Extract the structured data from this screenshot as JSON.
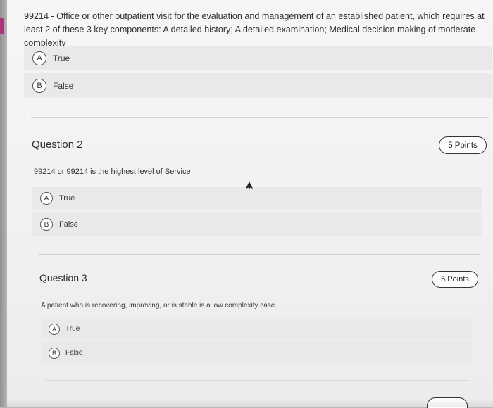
{
  "questions": [
    {
      "text": "99214 - Office or other outpatient visit for the evaluation and management of an established patient, which requires at least 2 of these 3 key components: A detailed history; A detailed examination; Medical decision making of moderate complexity",
      "options": [
        {
          "letter": "A",
          "label": "True"
        },
        {
          "letter": "B",
          "label": "False"
        }
      ]
    },
    {
      "title": "Question 2",
      "points": "5 Points",
      "text": "99214 or 99214 is the highest level of Service",
      "options": [
        {
          "letter": "A",
          "label": "True"
        },
        {
          "letter": "B",
          "label": "False"
        }
      ]
    },
    {
      "title": "Question 3",
      "points": "5 Points",
      "text": "A patient who is recovering, improving, or is stable is a low complexity case.",
      "options": [
        {
          "letter": "A",
          "label": "True"
        },
        {
          "letter": "B",
          "label": "False"
        }
      ]
    }
  ],
  "icons": {
    "cursor": "mouse-pointer-icon"
  },
  "colors": {
    "accent": "#b0327a",
    "option_background": "#e9e9e9",
    "page_background": "#f4f4f4"
  }
}
